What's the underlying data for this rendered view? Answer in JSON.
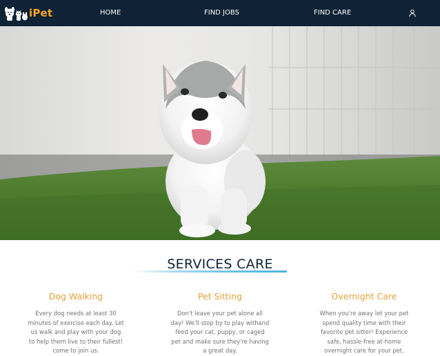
{
  "nav": {
    "logo_text": "iPet",
    "links": [
      "HOME",
      "FIND JOBS",
      "FIND CARE"
    ],
    "user_icon": "user-icon"
  },
  "hero": {
    "image": "husky puppy walking on grass",
    "slide_count": 3,
    "active_slide": 1
  },
  "services": {
    "title": "SERVICES CARE",
    "items": [
      {
        "title": "Dog Walking",
        "lines": [
          "Every dog needs at least 30",
          "minutes of exercise each day. Let",
          "us walk and play with your dog",
          "to help them live to their fullest!",
          "come to join us."
        ]
      },
      {
        "title": "Pet Sitting",
        "lines": [
          "Don't leave your pet alone all",
          "day! We'll stop by to play withand",
          "feed your cat, puppy, or caged",
          "pet and make sure they're having",
          "a great day."
        ]
      },
      {
        "title": "Overnight Care",
        "lines": [
          "When you're away let your pet",
          "spend quality time with their",
          "favorite pet sitter! Experience",
          "safe, hassle-free at-home",
          "overnight care for your pet."
        ]
      }
    ]
  },
  "colors": {
    "nav_bg": "#0f2236",
    "accent_orange": "#e3a03a",
    "title_color": "#0f2236",
    "underline_blue": "#4fb3e0"
  }
}
